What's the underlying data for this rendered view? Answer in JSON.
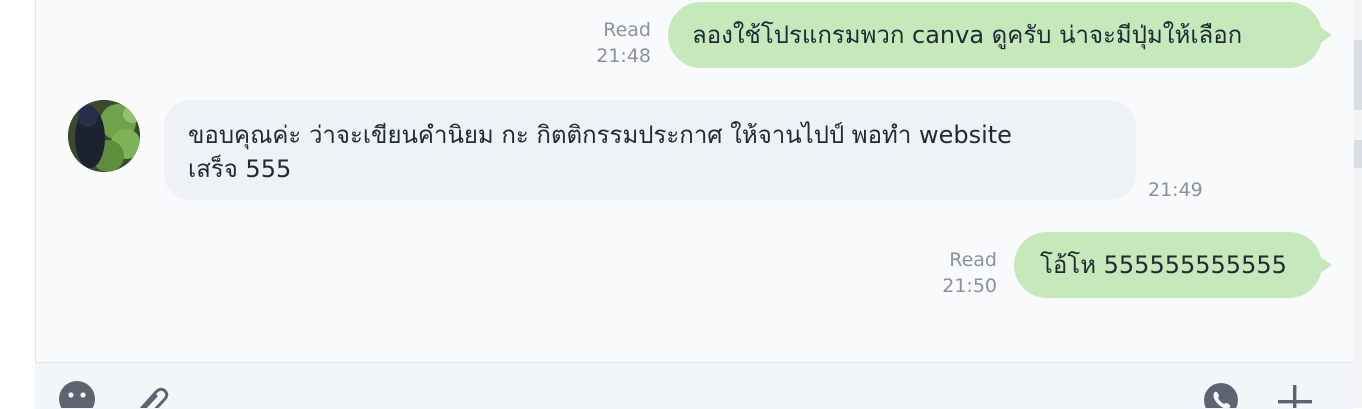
{
  "messages": [
    {
      "direction": "outgoing",
      "read_label": "Read",
      "time": "21:48",
      "text": "ลองใช้โปรแกรมพวก canva ดูครับ น่าจะมีปุ่มให้เลือก"
    },
    {
      "direction": "incoming",
      "time": "21:49",
      "lines": [
        "ขอบคุณค่ะ ว่าจะเขียนคำนิยม กะ กิตติกรรมประกาศ ให้จานไปป์ พอทำ website",
        "เสร็จ 555"
      ]
    },
    {
      "direction": "outgoing",
      "read_label": "Read",
      "time": "21:50",
      "text": "โอ้โห 555555555555"
    }
  ],
  "toolbar": {
    "left_icons": [
      "emoji-icon",
      "attachment-icon"
    ],
    "right_icons": [
      "call-icon",
      "add-icon"
    ]
  },
  "colors": {
    "outgoing_bubble": "#c6e9bb",
    "incoming_bubble": "#eef1f5",
    "meta_text": "#8a929c",
    "icon": "#5b6470"
  }
}
